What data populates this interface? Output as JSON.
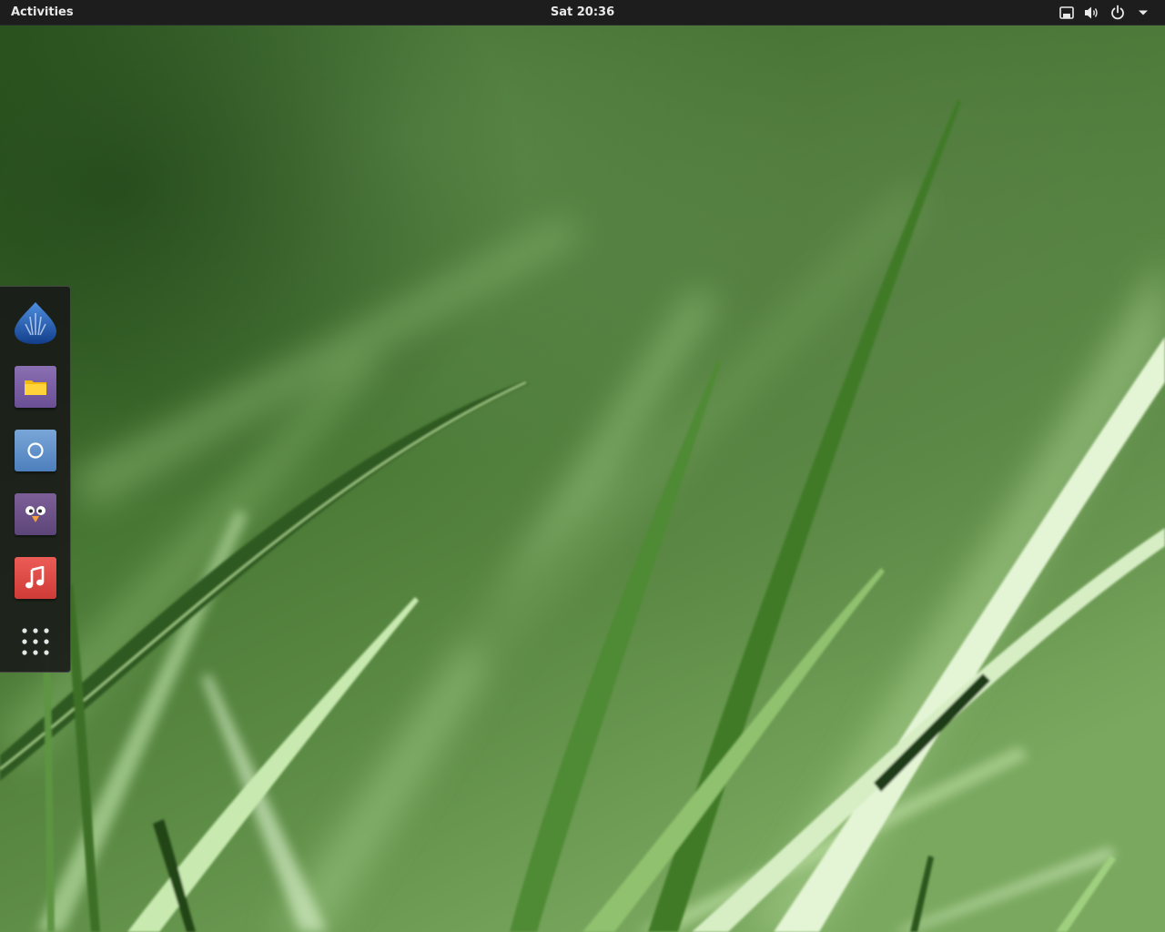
{
  "topbar": {
    "activities_label": "Activities",
    "clock": "Sat 20:36",
    "tray": {
      "icons": [
        "network-wired-icon",
        "volume-icon",
        "power-icon",
        "dropdown-arrow-icon"
      ]
    }
  },
  "dock": {
    "items": [
      {
        "icon": "anaconda-installer-icon",
        "color": "#1f56a8"
      },
      {
        "icon": "files-icon",
        "color": "#7a5fa6"
      },
      {
        "icon": "web-browser-icon",
        "color": "#5f8fca"
      },
      {
        "icon": "pidgin-icon",
        "color": "#6a5088"
      },
      {
        "icon": "music-icon",
        "color": "#e04a45"
      },
      {
        "icon": "show-applications-icon",
        "color": "#e6e6e6"
      }
    ]
  },
  "colors": {
    "topbar_bg": "#1d1d1d",
    "topbar_text": "#e8e8e8",
    "dock_bg": "#181818",
    "wallpaper_base": "#3d6b2a"
  }
}
